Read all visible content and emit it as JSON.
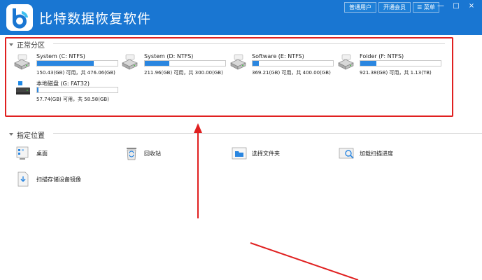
{
  "app": {
    "title": "比特数据恢复软件"
  },
  "toolbar": {
    "normal_user": "普通用户",
    "open_member": "开通会员",
    "menu": "菜单"
  },
  "window_controls": {
    "minimize": "—",
    "maximize": "□",
    "close": "×"
  },
  "partitions": {
    "heading": "正常分区",
    "drives": [
      {
        "name": "System (C: NTFS)",
        "size": "150.43(GB) 可用，共 476.06(GB)",
        "used_fraction": 0.7
      },
      {
        "name": "System (D: NTFS)",
        "size": "211.96(GB) 可用，共 300.00(GB)",
        "used_fraction": 0.3
      },
      {
        "name": "Software (E: NTFS)",
        "size": "369.21(GB) 可用，共 400.00(GB)",
        "used_fraction": 0.08
      },
      {
        "name": "Folder (F: NTFS)",
        "size": "921.38(GB) 可用，共 1.13(TB)",
        "used_fraction": 0.2
      },
      {
        "name": "本地磁盘 (G: FAT32)",
        "size": "57.74(GB) 可用，共 58.58(GB)",
        "used_fraction": 0.02
      }
    ]
  },
  "locations": {
    "heading": "指定位置",
    "items": [
      {
        "label": "桌面",
        "icon": "desktop-icon"
      },
      {
        "label": "回收站",
        "icon": "recycle-bin-icon"
      },
      {
        "label": "选择文件夹",
        "icon": "folder-icon"
      },
      {
        "label": "加载扫描进度",
        "icon": "scan-progress-icon"
      },
      {
        "label": "扫描存储设备镜像",
        "icon": "disk-image-icon"
      }
    ]
  },
  "colors": {
    "titlebar": "#1976d2",
    "accent": "#2a86e0",
    "annotation_red": "#e02020"
  }
}
